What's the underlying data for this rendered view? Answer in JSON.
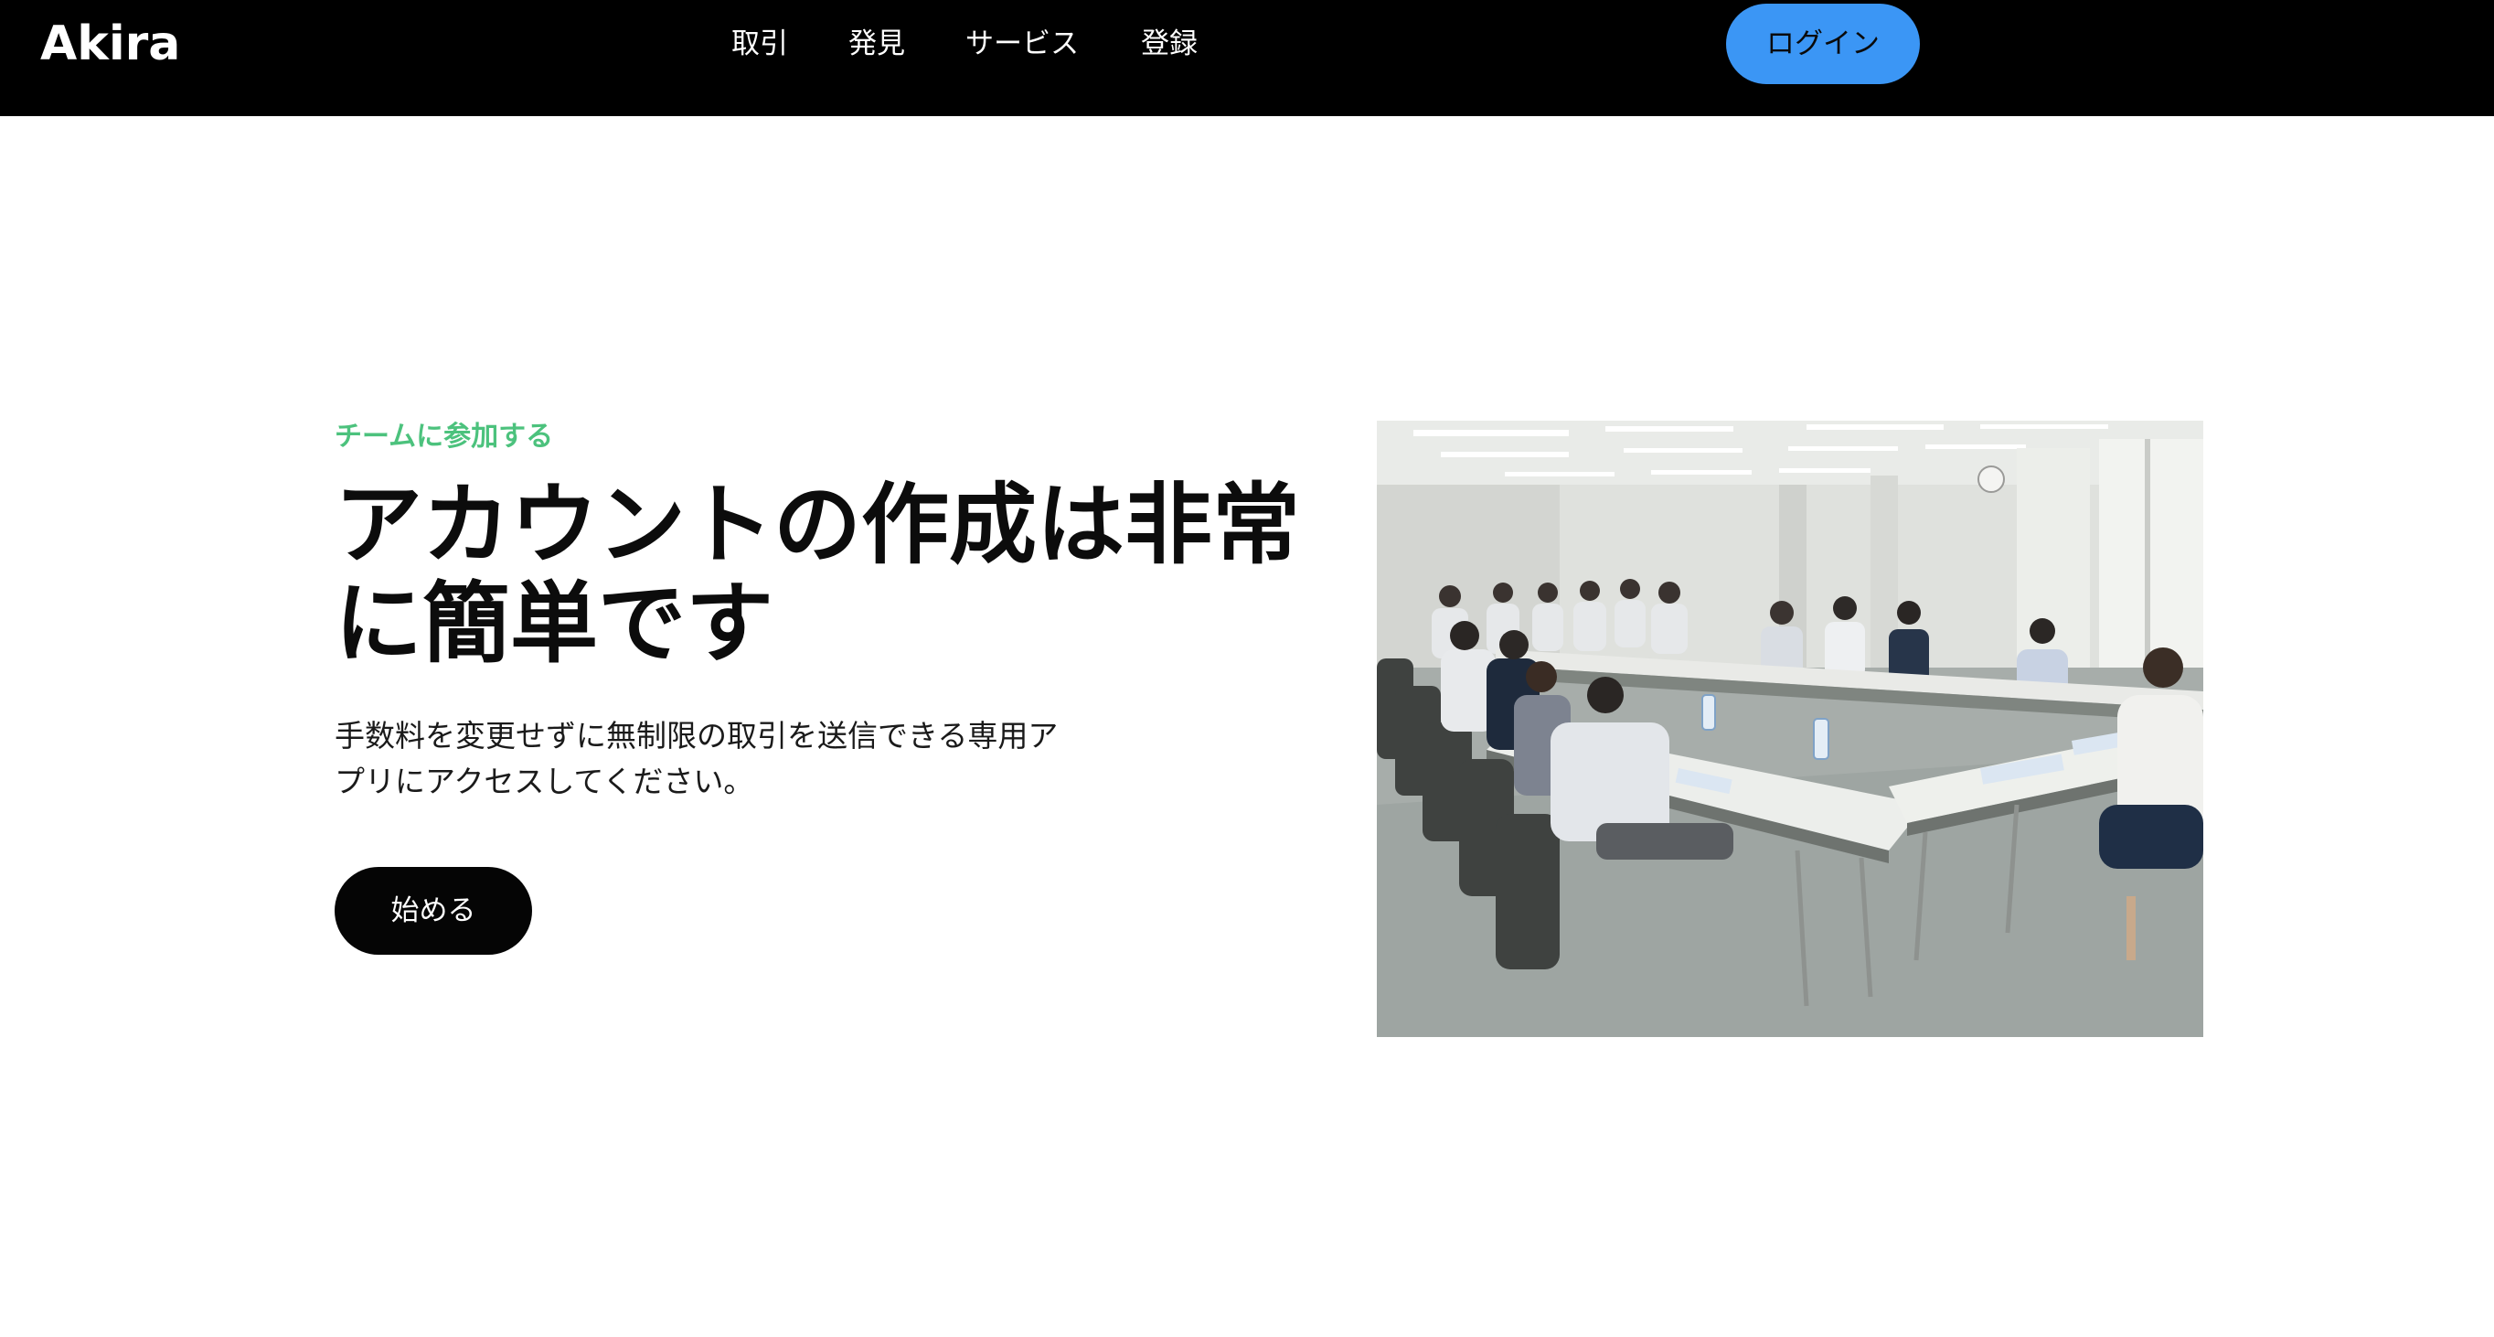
{
  "nav": {
    "brand": "Akira",
    "links": [
      {
        "label": "取引"
      },
      {
        "label": "発見"
      },
      {
        "label": "サービス"
      },
      {
        "label": "登録"
      }
    ],
    "login_label": "ログイン",
    "login_color": "#3b96f5"
  },
  "hero": {
    "eyebrow": "チームに参加する",
    "eyebrow_color": "#4cc27d",
    "headline_lines": [
      "アカウントの作成は非常",
      "に簡単です"
    ],
    "description_lines": [
      "手数料を変更せずに無制限の取引を送信できる専用ア",
      "プリにアクセスしてください。"
    ],
    "cta_label": "始める"
  },
  "image": {
    "subject": "meeting-room-photo"
  }
}
